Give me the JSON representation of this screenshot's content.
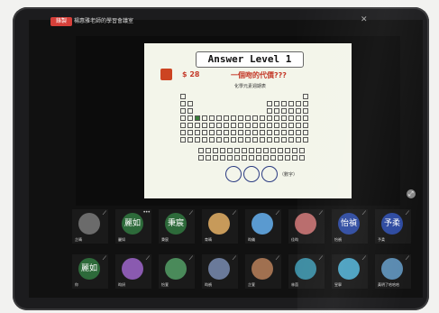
{
  "header": {
    "recording_badge": "錄製",
    "meeting_title": "楊惠雅老師的學習會議室"
  },
  "slide": {
    "banner": "Answer Level 1",
    "price": "$ 28",
    "question": "一個吻的代價???",
    "subtitle": "化學元素週期表",
    "answer_note": "（數字）",
    "answer_boxes": 3
  },
  "participants": [
    {
      "name": "芷晴",
      "avatar_text": "",
      "avatar_color": "#6b6b6b",
      "muted": true
    },
    {
      "name": "麗如",
      "avatar_text": "麗如",
      "avatar_color": "#2d6a3a",
      "muted": false,
      "more": "•••"
    },
    {
      "name": "秉宸",
      "avatar_text": "秉宸",
      "avatar_color": "#2d6a3a",
      "muted": true
    },
    {
      "name": "育晴",
      "avatar_text": "",
      "avatar_color": "#c79a5a",
      "muted": true
    },
    {
      "name": "昀儀",
      "avatar_text": "",
      "avatar_color": "#5a9ad0",
      "muted": true
    },
    {
      "name": "佳昀",
      "avatar_text": "",
      "avatar_color": "#b86a6a",
      "muted": true
    },
    {
      "name": "怡禎",
      "avatar_text": "怡禎",
      "avatar_color": "#2d4aa0",
      "muted": true
    },
    {
      "name": "予柔",
      "avatar_text": "予柔",
      "avatar_color": "#2d4aa0",
      "muted": true
    },
    {
      "name": "你",
      "avatar_text": "麗如",
      "avatar_color": "#2d6a3a",
      "muted": true
    },
    {
      "name": "昀妍",
      "avatar_text": "",
      "avatar_color": "#8a5ab0",
      "muted": true
    },
    {
      "name": "怡萱",
      "avatar_text": "",
      "avatar_color": "#4a8a5a",
      "muted": true
    },
    {
      "name": "昀禎",
      "avatar_text": "",
      "avatar_color": "#6a7a9a",
      "muted": true
    },
    {
      "name": "芷萱",
      "avatar_text": "",
      "avatar_color": "#a07050",
      "muted": true
    },
    {
      "name": "林茵",
      "avatar_text": "",
      "avatar_color": "#3a8aa0",
      "muted": true
    },
    {
      "name": "昱寧",
      "avatar_text": "",
      "avatar_color": "#4aa0c0",
      "muted": true
    },
    {
      "name": "黃明了哈哈哈",
      "avatar_text": "",
      "avatar_color": "#5a8ab0",
      "muted": true
    }
  ],
  "icons": {
    "mute": "mic-off-icon",
    "fullscreen": "expand-icon"
  },
  "colors": {
    "recording": "#d6403a",
    "slide_title": "#c43a2a",
    "answer_circle": "#2b3b82"
  }
}
